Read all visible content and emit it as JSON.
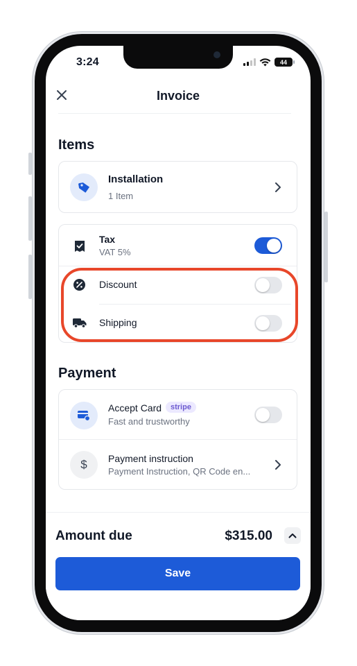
{
  "status_bar": {
    "time": "3:24",
    "battery": "44"
  },
  "header": {
    "title": "Invoice"
  },
  "items_section": {
    "title": "Items",
    "item": {
      "name": "Installation",
      "count": "1 Item"
    }
  },
  "adjustments": {
    "tax": {
      "label": "Tax",
      "sub": "VAT 5%",
      "enabled": true
    },
    "discount": {
      "label": "Discount",
      "enabled": false
    },
    "shipping": {
      "label": "Shipping",
      "enabled": false
    }
  },
  "payment_section": {
    "title": "Payment",
    "accept_card": {
      "label": "Accept Card",
      "badge": "stripe",
      "sub": "Fast and trustworthy",
      "enabled": false
    },
    "instruction": {
      "label": "Payment instruction",
      "sub": "Payment Instruction, QR Code en..."
    }
  },
  "footer": {
    "amount_label": "Amount due",
    "amount_value": "$315.00",
    "save_label": "Save"
  },
  "colors": {
    "accent": "#1d5bd8",
    "highlight": "#e8472a",
    "badge": "#6d5bd0"
  }
}
